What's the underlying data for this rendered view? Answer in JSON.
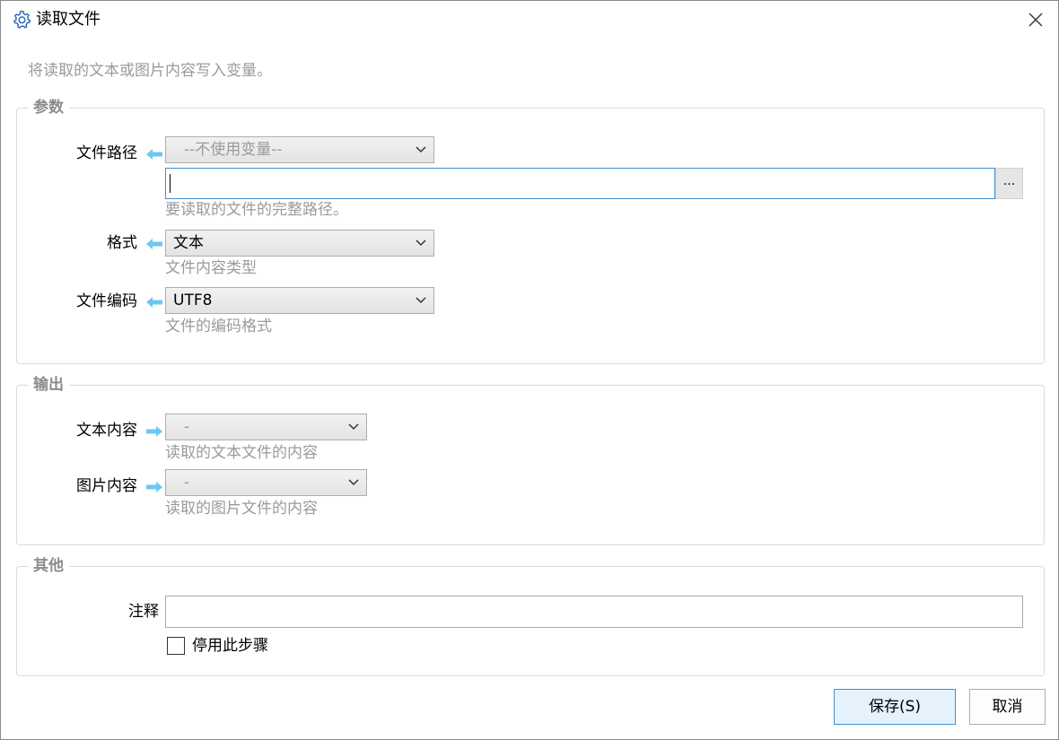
{
  "window": {
    "title": "读取文件",
    "icon": "gear-icon",
    "close_icon": "close-icon"
  },
  "description": "将读取的文本或图片内容写入变量。",
  "colors": {
    "accent": "#3c8fd5",
    "arrow": "#6cc8f2",
    "hint": "#9a9a9a"
  },
  "params": {
    "legend": "参数",
    "file_path": {
      "label": "文件路径",
      "variable_select": "--不使用变量--",
      "value": "",
      "browse_label": "...",
      "hint": "要读取的文件的完整路径。"
    },
    "format": {
      "label": "格式",
      "value": "文本",
      "hint": "文件内容类型"
    },
    "encoding": {
      "label": "文件编码",
      "value": "UTF8",
      "hint": "文件的编码格式"
    }
  },
  "output": {
    "legend": "输出",
    "text_content": {
      "label": "文本内容",
      "value": "-",
      "hint": "读取的文本文件的内容"
    },
    "image_content": {
      "label": "图片内容",
      "value": "-",
      "hint": "读取的图片文件的内容"
    }
  },
  "other": {
    "legend": "其他",
    "comment": {
      "label": "注释",
      "value": ""
    },
    "disable_step": {
      "label": "停用此步骤",
      "checked": false
    }
  },
  "buttons": {
    "save": "保存(S)",
    "cancel": "取消"
  }
}
